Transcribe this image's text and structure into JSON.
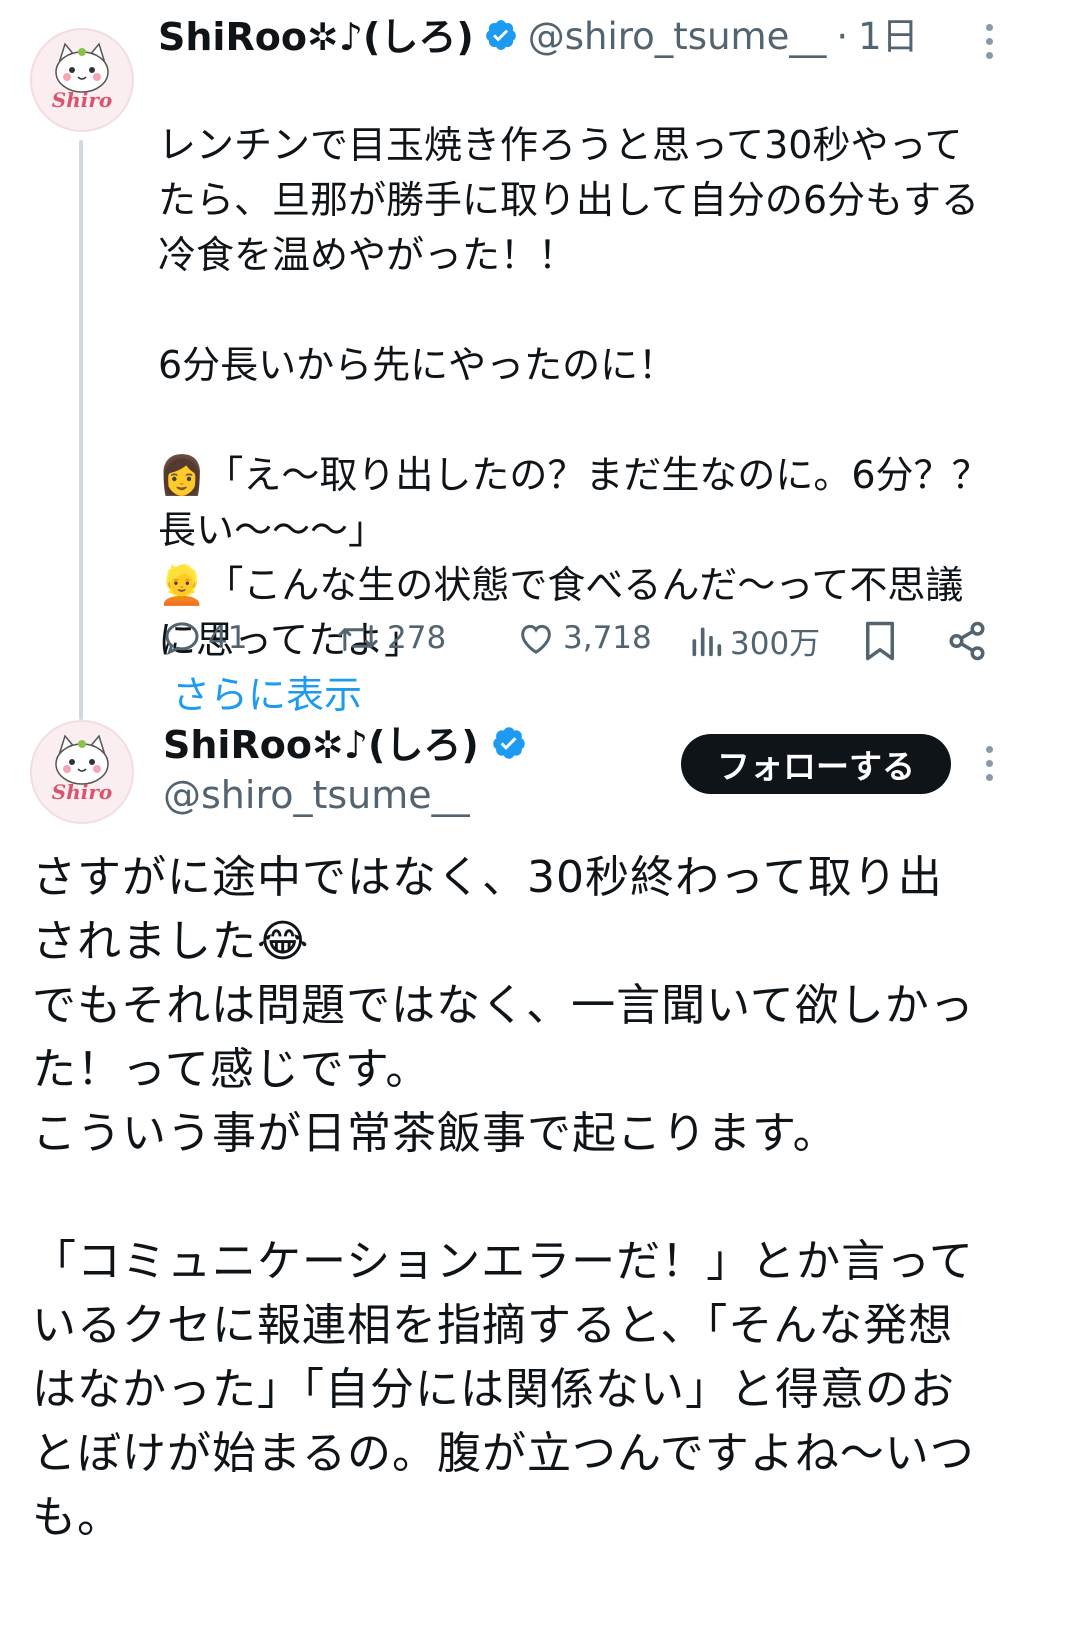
{
  "tweet1": {
    "display_name": "ShiRoo✲♪(しろ)",
    "handle": "@shiro_tsume__",
    "separator": "·",
    "time_ago": "1日",
    "avatar_text": "Shiro",
    "text": "レンチンで目玉焼き作ろうと思って30秒やって\nたら、旦那が勝手に取り出して自分の6分もする\n冷食を温めやがった！！\n\n6分長いから先にやったのに！\n\n👩「え〜取り出したの？まだ生なのに。6分？？\n長い〜〜〜」\n👱「こんな生の状態で食べるんだ〜って不思議\nに思ってたよ」",
    "show_more": "さらに表示",
    "actions": {
      "replies": "41",
      "reposts": "278",
      "likes": "3,718",
      "views": "300万"
    },
    "icons": [
      "reply-icon",
      "repost-icon",
      "like-icon",
      "views-icon",
      "bookmark-icon",
      "share-icon",
      "verified-icon",
      "more-icon"
    ]
  },
  "tweet2": {
    "display_name": "ShiRoo✲♪(しろ)",
    "handle": "@shiro_tsume__",
    "avatar_text": "Shiro",
    "follow_label": "フォローする",
    "text": "さすがに途中ではなく、30秒終わって取り出\nされました😂\nでもそれは問題ではなく、一言聞いて欲しかっ\nた！って感じです。\nこういう事が日常茶飯事で起こります。\n\n「コミュニケーションエラーだ！」とか言って\nいるクセに報連相を指摘すると、「そんな発想\nはなかった」「自分には関係ない」と得意のお\nとぼけが始まるの。腹が立つんですよね〜いつ\nも。"
  },
  "colors": {
    "accent": "#1d9bf0",
    "text": "#0f1419",
    "secondary_text": "#536471",
    "thread_line": "#cfd9de",
    "follow_button": "#0f1419"
  }
}
